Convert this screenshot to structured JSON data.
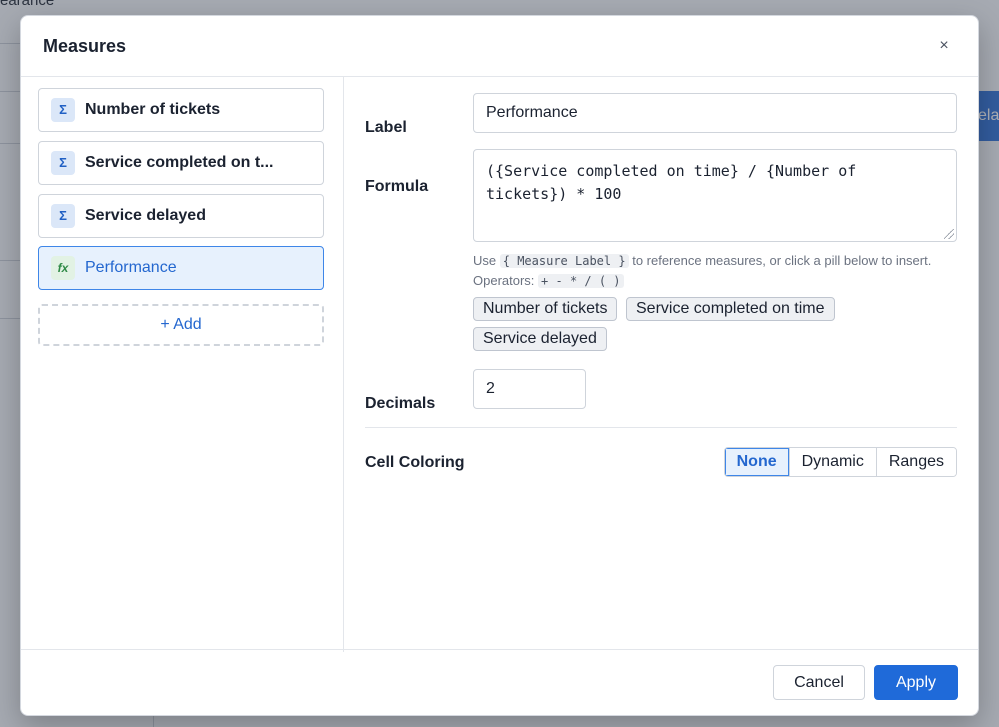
{
  "background": {
    "tab_label": "earance",
    "button_label": "ela"
  },
  "modal": {
    "title": "Measures",
    "close_glyph": "×"
  },
  "measures": [
    {
      "icon": "Σ",
      "icon_name": "sigma-icon",
      "label": "Number of tickets",
      "active": false
    },
    {
      "icon": "Σ",
      "icon_name": "sigma-icon",
      "label": "Service completed on t...",
      "active": false
    },
    {
      "icon": "Σ",
      "icon_name": "sigma-icon",
      "label": "Service delayed",
      "active": false
    },
    {
      "icon": "fx",
      "icon_name": "function-icon",
      "label": "Performance",
      "active": true
    }
  ],
  "add_label": "+ Add",
  "form": {
    "label_field": {
      "label": "Label",
      "value": "Performance"
    },
    "formula_field": {
      "label": "Formula",
      "value": "({Service completed on time} / {Number of tickets}) * 100"
    },
    "help": {
      "use": "Use",
      "token": "{ Measure Label }",
      "rest": "to reference measures, or click a pill below to insert.",
      "operators_label": "Operators:",
      "operators": "+ - * / ( )"
    },
    "pills": [
      "Number of tickets",
      "Service completed on time",
      "Service delayed"
    ],
    "decimals_field": {
      "label": "Decimals",
      "value": "2"
    },
    "cell_coloring": {
      "label": "Cell Coloring",
      "options": [
        "None",
        "Dynamic",
        "Ranges"
      ],
      "selected": "None"
    }
  },
  "footer": {
    "cancel_label": "Cancel",
    "apply_label": "Apply"
  },
  "colors": {
    "accent": "#1f6ad9",
    "active_bg": "#e7f1fd",
    "sigma_bg": "#dbe7f8",
    "fx_text": "#2f8a46"
  }
}
